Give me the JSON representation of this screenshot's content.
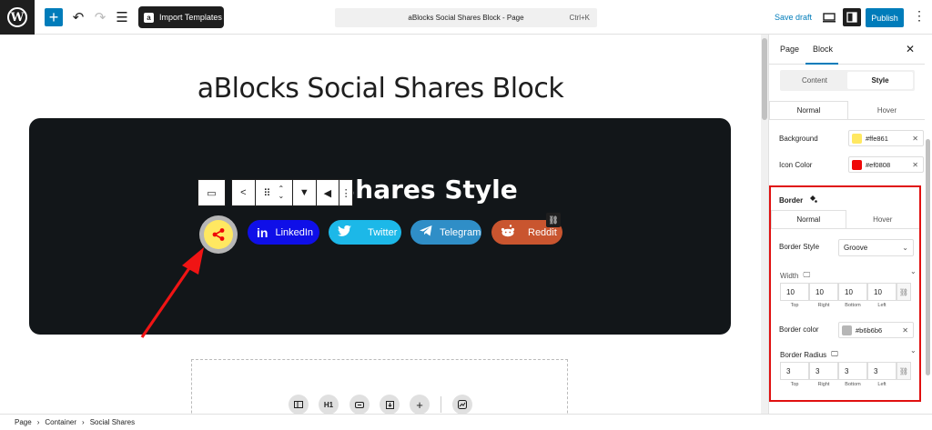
{
  "topbar": {
    "import_label": "Import Templates",
    "command_title": "aBlocks Social Shares Block - Page",
    "command_shortcut": "Ctrl+K",
    "save_draft": "Save draft",
    "publish": "Publish"
  },
  "canvas": {
    "page_title": "aBlocks Social Shares Block",
    "block_heading": "Social Shares Style",
    "shares": [
      {
        "label": "LinkedIn",
        "icon": "in",
        "color": "#0f0fe8"
      },
      {
        "label": "Twitter",
        "icon": "twitter-icon",
        "color": "#1cb8e8"
      },
      {
        "label": "Telegram",
        "icon": "telegram-icon",
        "color": "#2f8ec7"
      },
      {
        "label": "Reddit",
        "icon": "reddit-icon",
        "color": "#c9552f"
      }
    ],
    "quick_insert": [
      "H1"
    ]
  },
  "breadcrumb": [
    "Page",
    "Container",
    "Social Shares"
  ],
  "sidebar": {
    "tabs": [
      "Page",
      "Block"
    ],
    "mode_tabs": [
      "Content",
      "Style"
    ],
    "state_tabs": [
      "Normal",
      "Hover"
    ],
    "background_label": "Background",
    "background_value": "#ffe861",
    "icon_color_label": "Icon Color",
    "icon_color_value": "#ef0808",
    "border": {
      "title": "Border",
      "state_tabs": [
        "Normal",
        "Hover"
      ],
      "style_label": "Border Style",
      "style_value": "Groove",
      "width_label": "Width",
      "width_values": [
        "10",
        "10",
        "10",
        "10"
      ],
      "sides": [
        "Top",
        "Right",
        "Bottom",
        "Left"
      ],
      "color_label": "Border color",
      "color_value": "#b6b6b6",
      "radius_label": "Border Radius",
      "radius_values": [
        "3",
        "3",
        "3",
        "3"
      ]
    }
  }
}
